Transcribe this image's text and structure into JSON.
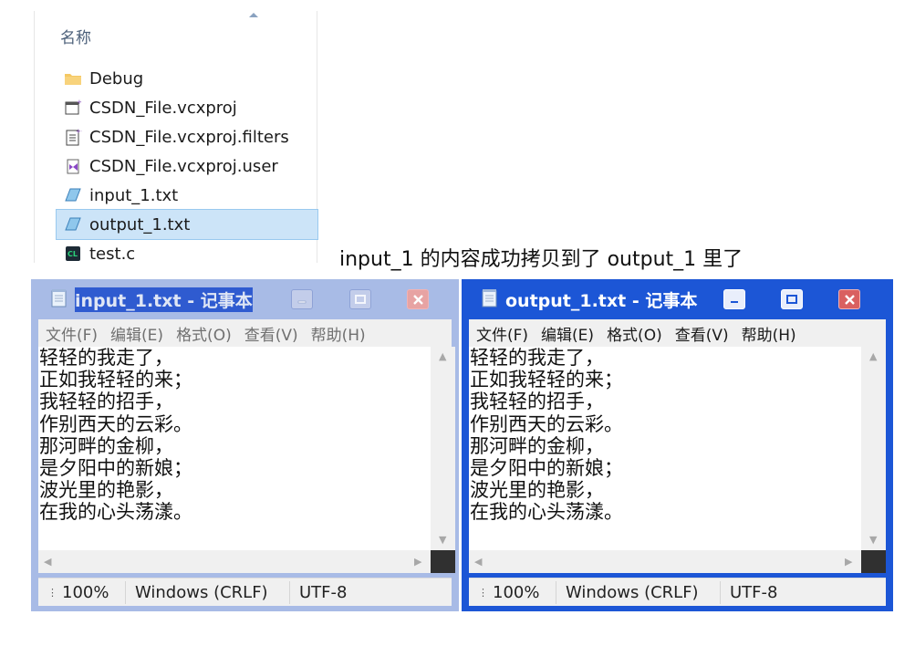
{
  "explorer": {
    "column_header": "名称",
    "files": [
      {
        "name": "Debug",
        "icon": "folder-icon"
      },
      {
        "name": "CSDN_File.vcxproj",
        "icon": "vcxproj-icon"
      },
      {
        "name": "CSDN_File.vcxproj.filters",
        "icon": "filters-icon"
      },
      {
        "name": "CSDN_File.vcxproj.user",
        "icon": "vs-user-icon"
      },
      {
        "name": "input_1.txt",
        "icon": "text-file-icon"
      },
      {
        "name": "output_1.txt",
        "icon": "text-file-icon",
        "selected": true
      },
      {
        "name": "test.c",
        "icon": "c-source-icon"
      }
    ]
  },
  "caption": "input_1 的内容成功拷贝到了 output_1 里了",
  "menu": [
    "文件(F)",
    "编辑(E)",
    "格式(O)",
    "查看(V)",
    "帮助(H)"
  ],
  "windows": [
    {
      "title": "input_1.txt - 记事本",
      "active": false,
      "lines": [
        "轻轻的我走了，",
        "正如我轻轻的来；",
        "我轻轻的招手，",
        "作别西天的云彩。",
        "那河畔的金柳，",
        "是夕阳中的新娘；",
        "波光里的艳影，",
        "在我的心头荡漾。"
      ],
      "status": {
        "zoom": "100%",
        "line_ending": "Windows (CRLF)",
        "encoding": "UTF-8"
      }
    },
    {
      "title": "output_1.txt - 记事本",
      "active": true,
      "lines": [
        "轻轻的我走了，",
        "正如我轻轻的来；",
        "我轻轻的招手，",
        "作别西天的云彩。",
        "那河畔的金柳，",
        "是夕阳中的新娘；",
        "波光里的艳影，",
        "在我的心头荡漾。"
      ],
      "status": {
        "zoom": "100%",
        "line_ending": "Windows (CRLF)",
        "encoding": "UTF-8"
      }
    }
  ],
  "colors": {
    "active_title": "#1c56d6",
    "inactive_title": "#a8bbe6",
    "selection": "#cce4f8"
  }
}
